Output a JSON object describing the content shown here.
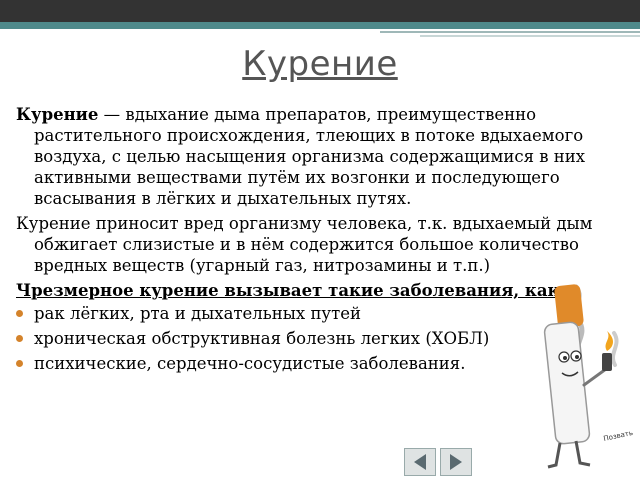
{
  "slide": {
    "title": "Курение",
    "para1_term": "Курение",
    "para1_rest": " — вдыхание дыма препаратов, преимущественно растительного происхождения, тлеющих в потоке вдыхаемого воздуха, с целью насыщения организма содержащимися в них активными веществами путём их возгонки и последующего всасывания в лёгких и дыхательных путях.",
    "para2": "Курение приносит вред организму человека, т.к. вдыхаемый дым обжигает слизистые и в нём содержится большое количество вредных веществ (угарный газ, нитрозамины и т.п.)",
    "heading": "Чрезмерное курение вызывает такие заболевания, как:",
    "bullets": [
      "рак лёгких, рта и дыхательных путей",
      "хроническая обструктивная болезнь легких (ХОБЛ)",
      "психические, сердечно-сосудистые заболевания."
    ],
    "illustration_caption": "Позвать Кашля!"
  },
  "colors": {
    "top_bar": "#333333",
    "accent": "#4f8a8b",
    "bullet": "#d4832b"
  },
  "nav": {
    "prev_icon": "arrow-left-icon",
    "next_icon": "arrow-right-icon"
  }
}
